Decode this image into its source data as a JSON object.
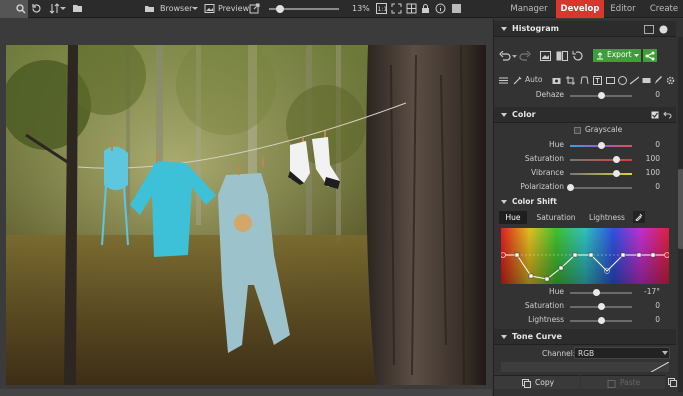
{
  "topbar": {
    "browser_label": "Browser",
    "preview_label": "Preview",
    "zoom_value": "13%",
    "modules": [
      {
        "label": "Manager"
      },
      {
        "label": "Develop"
      },
      {
        "label": "Editor"
      },
      {
        "label": "Create"
      }
    ]
  },
  "panel": {
    "histogram_title": "Histogram",
    "export_label": "Export",
    "auto_label": "Auto",
    "dehaze": {
      "label": "Dehaze",
      "value": "0",
      "level": 0.5
    },
    "color": {
      "title": "Color",
      "grayscale_label": "Grayscale",
      "sliders": [
        {
          "label": "Hue",
          "value": "0",
          "level": 0.5
        },
        {
          "label": "Saturation",
          "value": "100",
          "level": 0.75
        },
        {
          "label": "Vibrance",
          "value": "100",
          "level": 0.75
        },
        {
          "label": "Polarization",
          "value": "0",
          "level": 0.0
        }
      ]
    },
    "color_shift": {
      "title": "Color Shift",
      "tabs": [
        {
          "label": "Hue"
        },
        {
          "label": "Saturation"
        },
        {
          "label": "Lightness"
        }
      ],
      "sliders": [
        {
          "label": "Hue",
          "value": "-17°",
          "level": 0.42
        },
        {
          "label": "Saturation",
          "value": "0",
          "level": 0.5
        },
        {
          "label": "Lightness",
          "value": "0",
          "level": 0.5
        }
      ]
    },
    "tone_curve": {
      "title": "Tone Curve",
      "channel_label": "Channel:",
      "channel_value": "RGB"
    },
    "copy_label": "Copy",
    "paste_label": "Paste"
  },
  "colors": {
    "accent_red": "#d8372d",
    "export_green": "#3f9e3a"
  }
}
